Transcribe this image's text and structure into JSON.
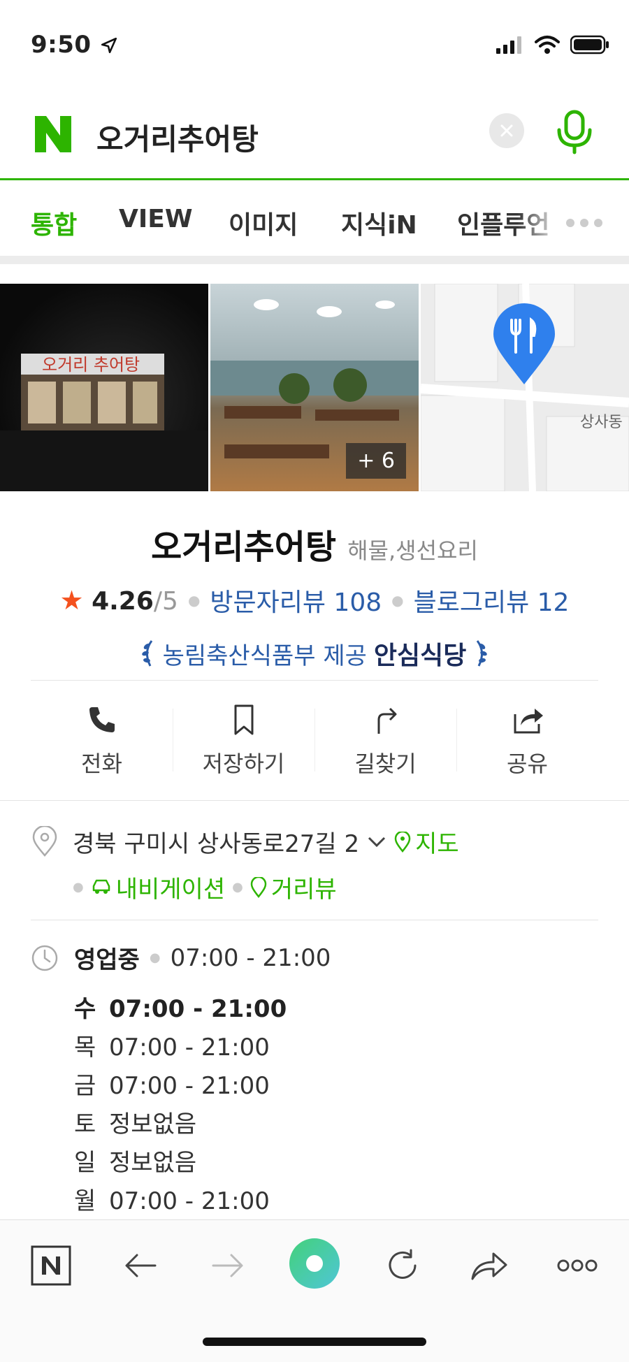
{
  "status_bar": {
    "time": "9:50"
  },
  "search": {
    "query": "오거리추어탕",
    "logo_letter": "N"
  },
  "tabs": [
    {
      "label": "통합",
      "active": true
    },
    {
      "label": "VIEW",
      "active": false
    },
    {
      "label": "이미지",
      "active": false
    },
    {
      "label": "지식iN",
      "active": false
    },
    {
      "label": "인플루언",
      "active": false
    }
  ],
  "photos": {
    "more_count": "+ 6",
    "map_label": "상사동"
  },
  "place": {
    "name": "오거리추어탕",
    "category": "해물,생선요리",
    "rating": "4.26",
    "rating_max": "/5",
    "visitor_reviews": "방문자리뷰 108",
    "blog_reviews": "블로그리뷰 12",
    "cert_provider": "농림축산식품부 제공",
    "cert_name": "안심식당"
  },
  "actions": [
    {
      "label": "전화",
      "icon": "phone-icon"
    },
    {
      "label": "저장하기",
      "icon": "bookmark-icon"
    },
    {
      "label": "길찾기",
      "icon": "directions-icon"
    },
    {
      "label": "공유",
      "icon": "share-icon"
    }
  ],
  "address": {
    "text": "경북 구미시 상사동로27길 2",
    "map_link": "지도",
    "navigation_link": "내비게이션",
    "street_view_link": "거리뷰"
  },
  "hours": {
    "status": "영업중",
    "range": "07:00 - 21:00",
    "days": [
      {
        "day": "수",
        "time": "07:00 - 21:00",
        "today": true
      },
      {
        "day": "목",
        "time": "07:00 - 21:00",
        "today": false
      },
      {
        "day": "금",
        "time": "07:00 - 21:00",
        "today": false
      },
      {
        "day": "토",
        "time": "정보없음",
        "today": false
      },
      {
        "day": "일",
        "time": "정보없음",
        "today": false
      },
      {
        "day": "월",
        "time": "07:00 - 21:00",
        "today": false
      }
    ]
  },
  "colors": {
    "brand_green": "#2db400",
    "link_blue": "#2a5ca8",
    "star_red": "#f4511e"
  }
}
